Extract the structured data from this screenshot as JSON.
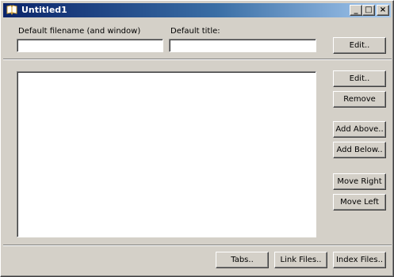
{
  "window": {
    "title": "Untitled1",
    "minimize": "_",
    "maximize": "□",
    "close": "×"
  },
  "top": {
    "filename_label": "Default filename (and window)",
    "filename_value": "",
    "title_label": "Default title:",
    "title_value": "",
    "edit_label": "Edit.."
  },
  "side_buttons": {
    "edit": "Edit..",
    "remove": "Remove",
    "add_above": "Add Above..",
    "add_below": "Add Below..",
    "move_right": "Move Right",
    "move_left": "Move Left"
  },
  "bottom_buttons": {
    "tabs": "Tabs..",
    "link_files": "Link Files..",
    "index_files": "Index Files.."
  }
}
